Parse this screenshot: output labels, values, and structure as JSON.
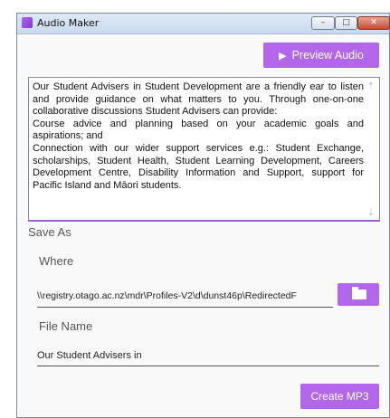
{
  "window": {
    "title": "Audio Maker",
    "controls": {
      "minimize": "–",
      "maximize": "□",
      "close": "✕"
    }
  },
  "toolbar": {
    "preview_label": "Preview Audio",
    "preview_icon": "▶"
  },
  "text_input": {
    "value": "Our Student Advisers in Student Development are a friendly ear to listen and provide guidance on what matters to you. Through one-on-one collaborative discussions Student Advisers can provide:\nCourse advice and planning based on your academic goals and aspirations; and\nConnection with our wider support services e.g.: Student Exchange, scholarships, Student Health, Student Learning Development, Careers Development Centre, Disability Information and Support, support for Pacific Island and Māori students."
  },
  "save_as": {
    "heading": "Save As",
    "where_label": "Where",
    "where_value": "\\\\registry.otago.ac.nz\\mdr\\Profiles-V2\\d\\dunst46p\\RedirectedF",
    "file_name_label": "File Name",
    "file_name_value": "Our Student Advisers in"
  },
  "actions": {
    "create_label": "Create MP3"
  },
  "colors": {
    "accent": "#b266e8"
  }
}
